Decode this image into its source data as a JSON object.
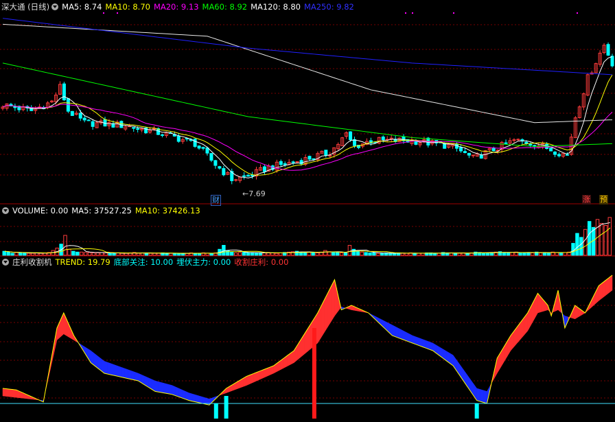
{
  "header1": {
    "title": "深大通 (日线)",
    "items": [
      {
        "label": "MA5: 8.74",
        "color": "#ffffff"
      },
      {
        "label": "MA10: 8.70",
        "color": "#ffff00"
      },
      {
        "label": "MA20: 9.13",
        "color": "#ff00ff"
      },
      {
        "label": "MA60: 8.92",
        "color": "#00ff00"
      },
      {
        "label": "MA120: 8.80",
        "color": "#ffffff"
      },
      {
        "label": "MA250: 9.82",
        "color": "#0000ff"
      }
    ]
  },
  "header2": {
    "items": [
      {
        "label": "VOLUME: 0.00",
        "color": "#ffffff"
      },
      {
        "label": "MA5: 37527.25",
        "color": "#ffffff"
      },
      {
        "label": "MA10: 37426.13",
        "color": "#ffff00"
      }
    ]
  },
  "header3": {
    "title": "庄利收割机",
    "items": [
      {
        "label": "TREND: 19.79",
        "color": "#ffff00"
      },
      {
        "label": "底部关注: 10.00",
        "color": "#00ffff"
      },
      {
        "label": "埋伏主力: 0.00",
        "color": "#00ffff"
      },
      {
        "label": "收割庄利: 0.00",
        "color": "#ff3333"
      }
    ]
  },
  "annotations": {
    "low_price": "7.69",
    "cai": "财",
    "zhang": "涨",
    "yu": "预"
  },
  "chart_data": [
    {
      "type": "line",
      "name": "price-panel",
      "title": "深大通 (日线)",
      "ylim": [
        7.4,
        10.6
      ],
      "x_count": 150,
      "series": [
        {
          "name": "MA5",
          "color": "#ffffff"
        },
        {
          "name": "MA10",
          "color": "#ffff00"
        },
        {
          "name": "MA20",
          "color": "#ff00ff"
        },
        {
          "name": "MA60",
          "color": "#00ff00"
        },
        {
          "name": "MA120",
          "color": "#ffffff"
        },
        {
          "name": "MA250",
          "color": "#0000ff"
        }
      ],
      "keypoints": {
        "close": [
          [
            0,
            9.05
          ],
          [
            7,
            8.95
          ],
          [
            12,
            9.1
          ],
          [
            14,
            9.35
          ],
          [
            16,
            8.95
          ],
          [
            20,
            8.75
          ],
          [
            30,
            8.7
          ],
          [
            40,
            8.55
          ],
          [
            47,
            8.4
          ],
          [
            52,
            8.05
          ],
          [
            56,
            7.8
          ],
          [
            60,
            7.85
          ],
          [
            65,
            8.0
          ],
          [
            72,
            8.1
          ],
          [
            80,
            8.25
          ],
          [
            84,
            8.55
          ],
          [
            86,
            8.35
          ],
          [
            90,
            8.45
          ],
          [
            100,
            8.45
          ],
          [
            110,
            8.35
          ],
          [
            115,
            8.15
          ],
          [
            120,
            8.3
          ],
          [
            125,
            8.45
          ],
          [
            130,
            8.4
          ],
          [
            138,
            8.2
          ],
          [
            140,
            8.85
          ],
          [
            143,
            9.5
          ],
          [
            147,
            10.05
          ],
          [
            150,
            9.6
          ]
        ],
        "MA250": [
          [
            0,
            10.5
          ],
          [
            60,
            10.0
          ],
          [
            100,
            9.75
          ],
          [
            150,
            9.55
          ]
        ],
        "MA120": [
          [
            0,
            10.4
          ],
          [
            50,
            10.2
          ],
          [
            90,
            9.3
          ],
          [
            130,
            8.75
          ],
          [
            150,
            8.8
          ]
        ],
        "MA60": [
          [
            0,
            9.75
          ],
          [
            20,
            9.45
          ],
          [
            60,
            8.85
          ],
          [
            100,
            8.5
          ],
          [
            130,
            8.35
          ],
          [
            150,
            8.4
          ]
        ]
      },
      "marks": {
        "low": 7.69
      }
    },
    {
      "type": "bar",
      "name": "volume-panel",
      "series": [
        {
          "name": "VOLUME"
        },
        {
          "name": "MA5"
        },
        {
          "name": "MA10"
        }
      ],
      "values_relative": [
        0.1,
        0.08,
        0.05,
        0.07,
        0.06,
        0.06,
        0.05,
        0.05,
        0.06,
        0.05,
        0.06,
        0.07,
        0.12,
        0.18,
        0.28,
        0.5,
        0.15,
        0.1,
        0.08,
        0.08,
        0.07,
        0.07,
        0.06,
        0.06,
        0.07,
        0.06,
        0.05,
        0.05,
        0.06,
        0.05,
        0.05,
        0.06,
        0.07,
        0.05,
        0.06,
        0.06,
        0.05,
        0.05,
        0.05,
        0.06,
        0.05,
        0.05,
        0.05,
        0.04,
        0.05,
        0.05,
        0.06,
        0.05,
        0.05,
        0.06,
        0.05,
        0.05,
        0.06,
        0.15,
        0.25,
        0.12,
        0.08,
        0.06,
        0.07,
        0.08,
        0.07,
        0.06,
        0.05,
        0.06,
        0.06,
        0.07,
        0.06,
        0.05,
        0.06,
        0.07,
        0.08,
        0.09,
        0.1,
        0.08,
        0.07,
        0.08,
        0.07,
        0.06,
        0.08,
        0.12,
        0.09,
        0.08,
        0.07,
        0.06,
        0.06,
        0.25,
        0.15,
        0.1,
        0.08,
        0.07,
        0.06,
        0.06,
        0.05,
        0.05,
        0.06,
        0.05,
        0.05,
        0.06,
        0.05,
        0.05,
        0.06,
        0.05,
        0.05,
        0.05,
        0.06,
        0.06,
        0.05,
        0.05,
        0.07,
        0.06,
        0.06,
        0.05,
        0.05,
        0.06,
        0.05,
        0.06,
        0.08,
        0.07,
        0.06,
        0.06,
        0.07,
        0.08,
        0.09,
        0.07,
        0.06,
        0.07,
        0.08,
        0.06,
        0.06,
        0.07,
        0.06,
        0.08,
        0.06,
        0.07,
        0.06,
        0.08,
        0.07,
        0.06,
        0.07,
        0.08,
        0.3,
        0.55,
        0.45,
        0.65,
        0.85,
        0.7,
        0.9,
        0.8,
        0.75,
        0.95
      ]
    },
    {
      "type": "area",
      "name": "indicator-panel",
      "title": "庄利收割机",
      "ylim": [
        0,
        100
      ],
      "series": [
        {
          "name": "TREND",
          "color": "#ffff00"
        }
      ],
      "trend_keypoints": [
        [
          0,
          20
        ],
        [
          4,
          19
        ],
        [
          8,
          15
        ],
        [
          12,
          11
        ],
        [
          16,
          60
        ],
        [
          18,
          70
        ],
        [
          21,
          55
        ],
        [
          26,
          37
        ],
        [
          30,
          30
        ],
        [
          40,
          25
        ],
        [
          45,
          18
        ],
        [
          50,
          16
        ],
        [
          55,
          12
        ],
        [
          61,
          9
        ],
        [
          66,
          20
        ],
        [
          72,
          28
        ],
        [
          80,
          35
        ],
        [
          86,
          45
        ],
        [
          93,
          70
        ],
        [
          98,
          92
        ],
        [
          100,
          72
        ],
        [
          103,
          75
        ],
        [
          108,
          70
        ],
        [
          115,
          55
        ],
        [
          121,
          50
        ],
        [
          127,
          45
        ],
        [
          133,
          35
        ],
        [
          140,
          12
        ],
        [
          143,
          10
        ],
        [
          146,
          40
        ],
        [
          150,
          55
        ],
        [
          155,
          70
        ],
        [
          158,
          83
        ],
        [
          161,
          75
        ],
        [
          162,
          68
        ],
        [
          164,
          85
        ],
        [
          166,
          60
        ],
        [
          169,
          75
        ],
        [
          172,
          70
        ],
        [
          176,
          88
        ],
        [
          180,
          95
        ]
      ],
      "ma_keypoints": [
        [
          0,
          15
        ],
        [
          4,
          14
        ],
        [
          8,
          13
        ],
        [
          12,
          12
        ],
        [
          16,
          52
        ],
        [
          18,
          56
        ],
        [
          21,
          52
        ],
        [
          26,
          45
        ],
        [
          30,
          38
        ],
        [
          40,
          30
        ],
        [
          45,
          25
        ],
        [
          50,
          22
        ],
        [
          55,
          17
        ],
        [
          61,
          13
        ],
        [
          66,
          17
        ],
        [
          72,
          22
        ],
        [
          80,
          30
        ],
        [
          86,
          37
        ],
        [
          93,
          50
        ],
        [
          98,
          68
        ],
        [
          100,
          74
        ],
        [
          103,
          72
        ],
        [
          108,
          70
        ],
        [
          115,
          62
        ],
        [
          121,
          55
        ],
        [
          127,
          50
        ],
        [
          133,
          42
        ],
        [
          140,
          20
        ],
        [
          143,
          18
        ],
        [
          146,
          30
        ],
        [
          150,
          45
        ],
        [
          155,
          58
        ],
        [
          158,
          70
        ],
        [
          161,
          72
        ],
        [
          162,
          70
        ],
        [
          164,
          72
        ],
        [
          166,
          68
        ],
        [
          169,
          66
        ],
        [
          172,
          70
        ],
        [
          176,
          78
        ],
        [
          180,
          85
        ]
      ],
      "base_level": 10,
      "signals": [
        {
          "x": 63,
          "value": 10
        },
        {
          "x": 66,
          "value": 15
        },
        {
          "x": 92,
          "value": 60
        },
        {
          "x": 140,
          "value": 10
        }
      ]
    }
  ]
}
